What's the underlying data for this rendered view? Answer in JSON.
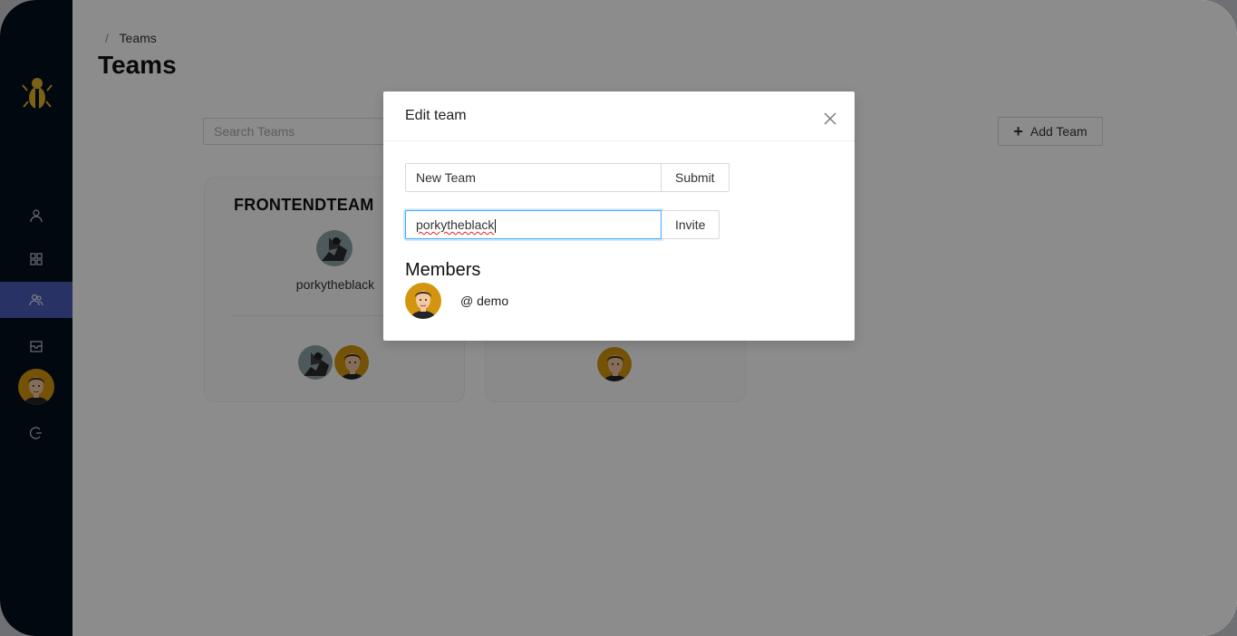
{
  "breadcrumb": {
    "separator": "/",
    "current": "Teams"
  },
  "page": {
    "title": "Teams"
  },
  "search": {
    "placeholder": "Search Teams"
  },
  "add_team": {
    "label": "Add Team",
    "icon": "plus-icon"
  },
  "sidebar": {
    "items": [
      {
        "name": "profile",
        "icon": "user-icon"
      },
      {
        "name": "dashboard",
        "icon": "grid-icon"
      },
      {
        "name": "teams",
        "icon": "team-icon",
        "active": true
      },
      {
        "name": "inbox",
        "icon": "inbox-icon"
      },
      {
        "name": "logout",
        "icon": "logout-icon"
      }
    ]
  },
  "cards": [
    {
      "title": "FRONTENDTEAM",
      "owner": "porkytheblack"
    }
  ],
  "modal": {
    "title": "Edit team",
    "team_name_value": "New Team",
    "submit_label": "Submit",
    "invite_value": "porkytheblack",
    "invite_label": "Invite",
    "members_heading": "Members",
    "members": [
      {
        "handle": "@ demo"
      }
    ]
  },
  "colors": {
    "sidebar_bg": "#030f1d",
    "active_nav": "#4a5cb7",
    "focus_border": "#40a9ff",
    "logo_gold": "#e0b028"
  }
}
